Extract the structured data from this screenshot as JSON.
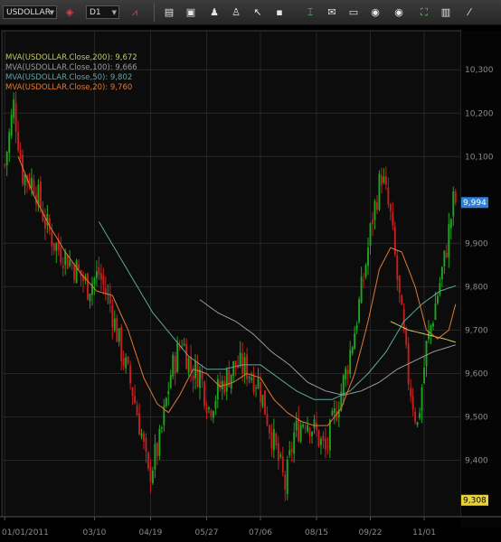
{
  "toolbar": {
    "symbol": "USDOLLAR",
    "timeframe": "D1",
    "icons": [
      "chart-type-icon",
      "indicator-icon",
      "bar-chart-icon",
      "crosshair-icon",
      "zoom-icon",
      "cursor-icon",
      "draw-point-icon",
      "fibonacci-icon",
      "comment-icon",
      "template-icon",
      "globe-icon",
      "trade-icon",
      "window-icon",
      "tools-icon"
    ]
  },
  "chart_data": {
    "type": "candlestick",
    "symbol": "USDOLLAR",
    "timeframe": "D1",
    "legend": [
      {
        "label": "MVA(USDOLLAR.Close,200): 9,672",
        "color": "#c8c860"
      },
      {
        "label": "MVA(USDOLLAR.Close,100): 9,666",
        "color": "#9a9a9a"
      },
      {
        "label": "MVA(USDOLLAR.Close,50): 9,802",
        "color": "#5fa7a0"
      },
      {
        "label": "MVA(USDOLLAR.Close,20): 9,760",
        "color": "#e07a30"
      }
    ],
    "ylim": [
      9270,
      10390
    ],
    "yticks": [
      "10,300",
      "10,200",
      "10,100",
      "9,900",
      "9,800",
      "9,700",
      "9,600",
      "9,500",
      "9,400"
    ],
    "ytick_values": [
      10300,
      10200,
      10100,
      9900,
      9800,
      9700,
      9600,
      9500,
      9400
    ],
    "last_price_label": "9,994",
    "last_price": 9994,
    "low_price_label": "9,308",
    "low_price": 9308,
    "xticks": [
      "01/01/2011",
      "03/10",
      "04/19",
      "05/27",
      "07/06",
      "08/15",
      "09/22",
      "11/01"
    ],
    "xtick_index": [
      0,
      40,
      65,
      90,
      114,
      139,
      163,
      187
    ],
    "bull_color": "#1fa51f",
    "bear_color": "#c81e1e",
    "anchors": [
      [
        0,
        10080
      ],
      [
        4,
        10220
      ],
      [
        8,
        10060
      ],
      [
        13,
        10040
      ],
      [
        18,
        9950
      ],
      [
        22,
        9900
      ],
      [
        27,
        9870
      ],
      [
        32,
        9840
      ],
      [
        37,
        9800
      ],
      [
        42,
        9830
      ],
      [
        47,
        9760
      ],
      [
        52,
        9650
      ],
      [
        57,
        9560
      ],
      [
        61,
        9460
      ],
      [
        64,
        9360
      ],
      [
        69,
        9440
      ],
      [
        74,
        9600
      ],
      [
        79,
        9680
      ],
      [
        83,
        9610
      ],
      [
        87,
        9600
      ],
      [
        91,
        9520
      ],
      [
        95,
        9560
      ],
      [
        99,
        9590
      ],
      [
        103,
        9620
      ],
      [
        108,
        9610
      ],
      [
        113,
        9580
      ],
      [
        118,
        9480
      ],
      [
        122,
        9400
      ],
      [
        125,
        9340
      ],
      [
        129,
        9460
      ],
      [
        134,
        9500
      ],
      [
        138,
        9470
      ],
      [
        143,
        9420
      ],
      [
        147,
        9500
      ],
      [
        152,
        9600
      ],
      [
        156,
        9700
      ],
      [
        160,
        9820
      ],
      [
        164,
        9960
      ],
      [
        168,
        10060
      ],
      [
        172,
        9960
      ],
      [
        176,
        9770
      ],
      [
        180,
        9590
      ],
      [
        184,
        9480
      ],
      [
        188,
        9660
      ],
      [
        192,
        9760
      ],
      [
        196,
        9860
      ],
      [
        200,
        9994
      ]
    ],
    "ma20": [
      [
        6,
        10100
      ],
      [
        13,
        10010
      ],
      [
        20,
        9940
      ],
      [
        27,
        9880
      ],
      [
        34,
        9830
      ],
      [
        41,
        9790
      ],
      [
        48,
        9780
      ],
      [
        55,
        9700
      ],
      [
        62,
        9590
      ],
      [
        68,
        9530
      ],
      [
        73,
        9510
      ],
      [
        78,
        9550
      ],
      [
        84,
        9610
      ],
      [
        90,
        9600
      ],
      [
        96,
        9570
      ],
      [
        102,
        9580
      ],
      [
        108,
        9600
      ],
      [
        114,
        9590
      ],
      [
        120,
        9540
      ],
      [
        126,
        9510
      ],
      [
        132,
        9490
      ],
      [
        138,
        9480
      ],
      [
        144,
        9480
      ],
      [
        150,
        9520
      ],
      [
        156,
        9600
      ],
      [
        162,
        9720
      ],
      [
        167,
        9840
      ],
      [
        172,
        9890
      ],
      [
        177,
        9880
      ],
      [
        183,
        9800
      ],
      [
        188,
        9700
      ],
      [
        193,
        9680
      ],
      [
        198,
        9700
      ],
      [
        201,
        9760
      ]
    ],
    "ma50": [
      [
        42,
        9950
      ],
      [
        50,
        9880
      ],
      [
        58,
        9810
      ],
      [
        66,
        9740
      ],
      [
        74,
        9690
      ],
      [
        82,
        9640
      ],
      [
        90,
        9610
      ],
      [
        98,
        9610
      ],
      [
        106,
        9620
      ],
      [
        114,
        9620
      ],
      [
        122,
        9590
      ],
      [
        130,
        9560
      ],
      [
        138,
        9540
      ],
      [
        146,
        9540
      ],
      [
        154,
        9560
      ],
      [
        162,
        9600
      ],
      [
        170,
        9650
      ],
      [
        178,
        9720
      ],
      [
        186,
        9760
      ],
      [
        194,
        9790
      ],
      [
        201,
        9802
      ]
    ],
    "ma100": [
      [
        87,
        9770
      ],
      [
        95,
        9740
      ],
      [
        103,
        9720
      ],
      [
        111,
        9690
      ],
      [
        119,
        9650
      ],
      [
        127,
        9620
      ],
      [
        135,
        9580
      ],
      [
        143,
        9560
      ],
      [
        151,
        9550
      ],
      [
        159,
        9560
      ],
      [
        167,
        9580
      ],
      [
        175,
        9610
      ],
      [
        183,
        9630
      ],
      [
        191,
        9650
      ],
      [
        201,
        9666
      ]
    ],
    "ma200": [
      [
        172,
        9720
      ],
      [
        180,
        9700
      ],
      [
        188,
        9690
      ],
      [
        196,
        9680
      ],
      [
        201,
        9672
      ]
    ]
  }
}
